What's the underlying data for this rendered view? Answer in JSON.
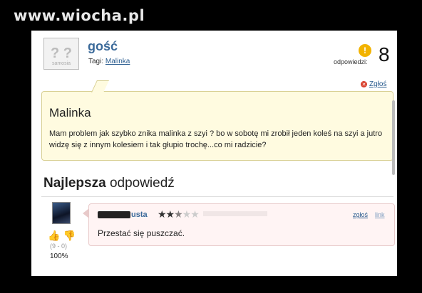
{
  "watermark": "www.wiocha.pl",
  "question": {
    "user": "gość",
    "avatar_caption": "samosia",
    "tags_label": "Tagi:",
    "tag": "Malinka",
    "answers_label": "odpowiedzi:",
    "answers_count": "8",
    "report_label": "Zgłoś",
    "title": "Malinka",
    "text": "Mam problem jak szybko znika malinka z szyi ? bo w sobotę mi zrobił jeden koleś na szyi a jutro widzę się z innym kolesiem i tak głupio trochę...co mi radzicie?"
  },
  "best_answer": {
    "heading_bold": "Najlepsza",
    "heading_rest": "odpowiedź",
    "user_partial": "usta",
    "rating": 2.5,
    "report_label": "zgłoś",
    "link_label": "link",
    "text": "Przestać się puszczać.",
    "votes": "(9 - 0)",
    "percent": "100%"
  },
  "colors": {
    "accent": "#3b6a9a",
    "question_bg": "#fffbe0",
    "answer_bg": "#fff4f4"
  }
}
